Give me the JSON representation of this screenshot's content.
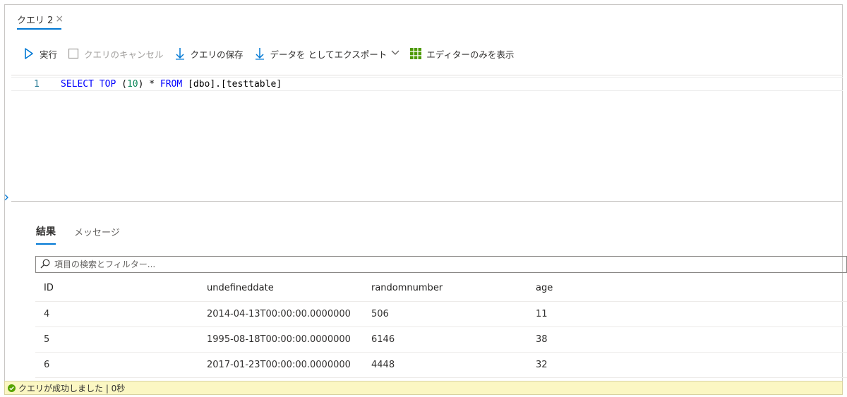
{
  "tab": {
    "title": "クエリ 2",
    "close_glyph": "×"
  },
  "toolbar": {
    "run": "実行",
    "cancel": "クエリのキャンセル",
    "save": "クエリの保存",
    "export": "データを としてエクスポート",
    "editor_only": "エディターのみを表示"
  },
  "editor": {
    "line_number": "1",
    "tokens": {
      "select": "SELECT",
      "top": "TOP",
      "open_paren": " (",
      "ten": "10",
      "rest1": ") * ",
      "from": "FROM",
      "rest2": " [dbo].[testtable]"
    }
  },
  "results": {
    "tab_results": "結果",
    "tab_messages": "メッセージ",
    "search_placeholder": "項目の検索とフィルター...",
    "columns": [
      "ID",
      "undefineddate",
      "randomnumber",
      "age"
    ],
    "rows": [
      [
        "4",
        "2014-04-13T00:00:00.0000000",
        "506",
        "11"
      ],
      [
        "5",
        "1995-08-18T00:00:00.0000000",
        "6146",
        "38"
      ],
      [
        "6",
        "2017-01-23T00:00:00.0000000",
        "4448",
        "32"
      ]
    ]
  },
  "status": {
    "message": "クエリが成功しました | 0秒"
  },
  "colors": {
    "accent": "#0078d4",
    "status_bg": "#fbf7c3",
    "success": "#57a300"
  }
}
